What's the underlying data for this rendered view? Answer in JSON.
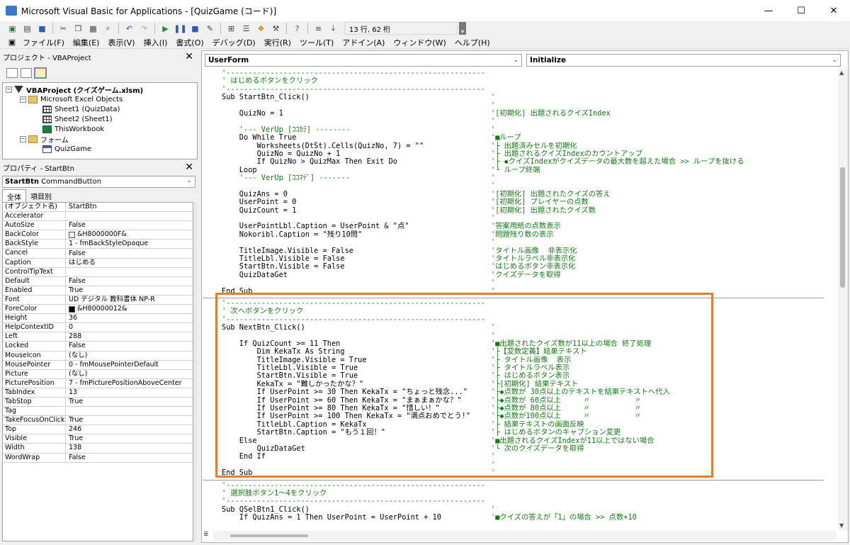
{
  "window": {
    "title": "Microsoft Visual Basic for Applications - [QuizGame (コード)]",
    "controls": [
      "—",
      "☐",
      "✕"
    ]
  },
  "toolbar": {
    "icons": [
      "excel-icon",
      "insert-icon",
      "save-icon",
      "cut-icon",
      "copy-icon",
      "paste-icon",
      "find-icon",
      "undo-icon",
      "redo-icon",
      "run-icon",
      "break-icon",
      "reset-icon",
      "design-icon",
      "project-icon",
      "properties-icon",
      "object-browser-icon",
      "toolbox-icon",
      "help-icon"
    ],
    "cursor_position": "13 行, 62 桁"
  },
  "menubar": {
    "items": [
      "ファイル(F)",
      "編集(E)",
      "表示(V)",
      "挿入(I)",
      "書式(O)",
      "デバッグ(D)",
      "実行(R)",
      "ツール(T)",
      "アドイン(A)",
      "ウィンドウ(W)",
      "ヘルプ(H)"
    ]
  },
  "project_panel": {
    "title": "プロジェクト - VBAProject",
    "tree": [
      {
        "label": "VBAProject (クイズゲーム.xlsm)",
        "level": 0,
        "icon": "project-icon",
        "toggle": "−",
        "bold": true
      },
      {
        "label": "Microsoft Excel Objects",
        "level": 1,
        "icon": "folder-icon",
        "toggle": "−"
      },
      {
        "label": "Sheet1 (QuizData)",
        "level": 2,
        "icon": "sheet-icon"
      },
      {
        "label": "Sheet2 (Sheet1)",
        "level": 2,
        "icon": "sheet-icon"
      },
      {
        "label": "ThisWorkbook",
        "level": 2,
        "icon": "workbook-icon"
      },
      {
        "label": "フォーム",
        "level": 1,
        "icon": "folder-icon",
        "toggle": "−"
      },
      {
        "label": "QuizGame",
        "level": 2,
        "icon": "form-icon"
      }
    ]
  },
  "properties_panel": {
    "title": "プロパティ - StartBtn",
    "object_combo": "StartBtn CommandButton",
    "object_combo_name": "StartBtn",
    "object_combo_type": "CommandButton",
    "tabs": [
      "全体",
      "項目別"
    ],
    "rows": [
      [
        "(オブジェクト名)",
        "StartBtn"
      ],
      [
        "Accelerator",
        ""
      ],
      [
        "AutoSize",
        "False"
      ],
      [
        "BackColor",
        "&H8000000F&"
      ],
      [
        "BackStyle",
        "1 - fmBackStyleOpaque"
      ],
      [
        "Cancel",
        "False"
      ],
      [
        "Caption",
        "はじめる"
      ],
      [
        "ControlTipText",
        ""
      ],
      [
        "Default",
        "False"
      ],
      [
        "Enabled",
        "True"
      ],
      [
        "Font",
        "UD デジタル 教科書体 NP-R"
      ],
      [
        "ForeColor",
        "&H80000012&"
      ],
      [
        "Height",
        "36"
      ],
      [
        "HelpContextID",
        "0"
      ],
      [
        "Left",
        "288"
      ],
      [
        "Locked",
        "False"
      ],
      [
        "MouseIcon",
        "(なし)"
      ],
      [
        "MousePointer",
        "0 - fmMousePointerDefault"
      ],
      [
        "Picture",
        "(なし)"
      ],
      [
        "PicturePosition",
        "7 - fmPicturePositionAboveCenter"
      ],
      [
        "TabIndex",
        "13"
      ],
      [
        "TabStop",
        "True"
      ],
      [
        "Tag",
        ""
      ],
      [
        "TakeFocusOnClick",
        "True"
      ],
      [
        "Top",
        "246"
      ],
      [
        "Visible",
        "True"
      ],
      [
        "Width",
        "138"
      ],
      [
        "WordWrap",
        "False"
      ]
    ],
    "swatches": {
      "BackColor": "#f0f0f0",
      "ForeColor": "#000000"
    }
  },
  "code_window": {
    "object_combo": "UserForm",
    "proc_combo": "Initialize",
    "lines": [
      {
        "c": "'-----------------------------------------------------------"
      },
      {
        "c": "' はじめるボタンをクリック"
      },
      {
        "c": "'-----------------------------------------------------------"
      },
      {
        "t": "Sub StartBtn_Click()",
        "c": "'"
      },
      {
        "t": "",
        "c": "'"
      },
      {
        "t": "    QuizNo = 1",
        "c": "'[初期化] 出題されるクイズIndex"
      },
      {
        "t": "",
        "c": "'"
      },
      {
        "t": "    '--- VerUp [ｺｺｶﾗ] --------",
        "tc": true,
        "c": "'"
      },
      {
        "t": "    Do While True",
        "c": "'■ループ"
      },
      {
        "t": "        Worksheets(DtSt).Cells(QuizNo, 7) = \"\"",
        "c": "'├ 出題済みセルを初期化"
      },
      {
        "t": "        QuizNo = QuizNo + 1",
        "c": "'├ 出題されるクイズIndexのカウントアップ"
      },
      {
        "t": "        If QuizNo > QuizMax Then Exit Do",
        "c": "'├ ◆クイズIndexがクイズデータの最大数を超えた場合 >> ループを抜ける"
      },
      {
        "t": "    Loop",
        "c": "'└ ループ終端"
      },
      {
        "t": "    '--- VerUp [ｺｺﾏﾃﾞ] -------",
        "tc": true,
        "c": "'"
      },
      {
        "t": "",
        "c": "'"
      },
      {
        "t": "    QuizAns = 0",
        "c": "'[初期化] 出題されたクイズの答え"
      },
      {
        "t": "    UserPoint = 0",
        "c": "'[初期化] プレイヤーの点数"
      },
      {
        "t": "    QuizCount = 1",
        "c": "'[初期化] 出題されたクイズ数"
      },
      {
        "t": "",
        "c": "'"
      },
      {
        "t": "    UserPointLbl.Caption = UserPoint & \"点\"",
        "c": "'答案用紙の点数表示"
      },
      {
        "t": "    Nokoribl.Caption = \"残り10問\"",
        "c": "'問題残り数の表示"
      },
      {
        "t": "",
        "c": "'"
      },
      {
        "t": "    TitleImage.Visible = False",
        "c": "'タイトル画像  非表示化"
      },
      {
        "t": "    TitleLbl.Visible = False",
        "c": "'タイトルラベル非表示化"
      },
      {
        "t": "    StartBtn.Visible = False",
        "c": "'はじめるボタン非表示化"
      },
      {
        "t": "    QuizDataGet",
        "c": "'クイズデータを取得"
      },
      {
        "t": "",
        "c": "'"
      },
      {
        "t": "End Sub",
        "c": "'"
      },
      {
        "sep": true
      },
      {
        "c": "'-----------------------------------------------------------"
      },
      {
        "c": "' 次へボタンをクリック"
      },
      {
        "c": "'-----------------------------------------------------------"
      },
      {
        "t": "Sub NextBtn_Click()",
        "c": "'"
      },
      {
        "t": "",
        "c": "'"
      },
      {
        "t": "    If QuizCount >= 11 Then",
        "c": "'■出題されたクイズ数が11以上の場合 終了処理"
      },
      {
        "t": "        Dim KekaTx As String",
        "c": "'├【変数定義】結果テキスト"
      },
      {
        "t": "        TitleImage.Visible = True",
        "c": "'├ タイトル画像  表示"
      },
      {
        "t": "        TitleLbl.Visible = True",
        "c": "'├ タイトルラベル表示"
      },
      {
        "t": "        StartBtn.Visible = True",
        "c": "'├ はじめるボタン表示"
      },
      {
        "t": "        KekaTx = \"難しかったかな？\"",
        "c": "'├[初期化] 結果テキスト"
      },
      {
        "t": "        If UserPoint >= 30 Then KekaTx = \"ちょっと残念...\"",
        "c": "'├◆点数が 30点以上のテキストを結果テキストへ代入"
      },
      {
        "t": "        If UserPoint >= 60 Then KekaTx = \"まぁまぁかな？\"",
        "c": "'├◆点数が 60点以上     〃          〃"
      },
      {
        "t": "        If UserPoint >= 80 Then KekaTx = \"惜しい！\"",
        "c": "'├◆点数が 80点以上     〃          〃"
      },
      {
        "t": "        If UserPoint >= 100 Then KekaTx = \"満点おめでとう!\"",
        "c": "'├◆点数が100点以上     〃          〃"
      },
      {
        "t": "        TitleLbl.Caption = KekaTx",
        "c": "'├ 結果テキストの画面反映"
      },
      {
        "t": "        StartBtn.Caption = \"もう１回！\"",
        "c": "'├ はじめるボタンのキャプション変更"
      },
      {
        "t": "    Else",
        "c": "'■出題されるクイズIndexが11以上ではない場合"
      },
      {
        "t": "        QuizDataGet",
        "c": "'└ 次のクイズデータを取得"
      },
      {
        "t": "    End If",
        "c": "'"
      },
      {
        "t": "",
        "c": "'"
      },
      {
        "t": "End Sub",
        "c": "'"
      },
      {
        "sep": true
      },
      {
        "c": "'-----------------------------------------------------------"
      },
      {
        "c": "' 選択肢ボタン1～4をクリック"
      },
      {
        "c": "'-----------------------------------------------------------"
      },
      {
        "t": "Sub QSelBtn1_Click()",
        "c": "'"
      },
      {
        "t": "    If QuizAns = 1 Then UserPoint = UserPoint + 10",
        "c": "'■クイズの答えが「1」の場合 >> 点数+10"
      }
    ]
  },
  "colors": {
    "comment": "#157a15",
    "highlight_border": "#e47f2f"
  }
}
